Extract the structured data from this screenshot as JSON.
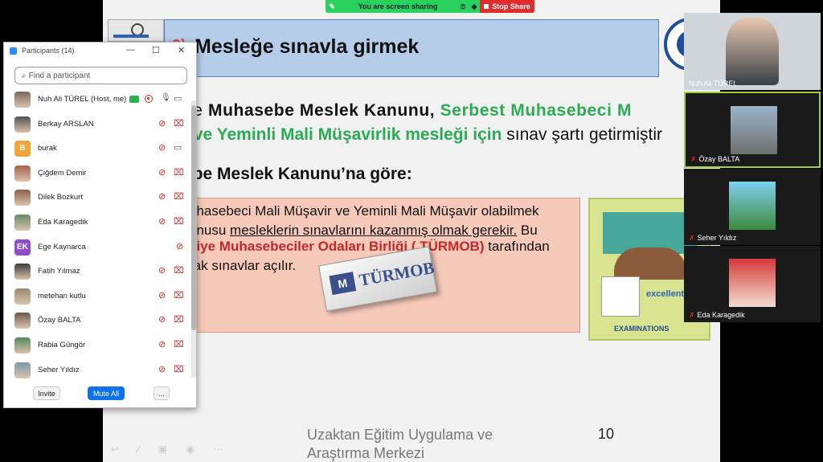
{
  "share_bar": {
    "status_label": "You are screen sharing",
    "stop_label": "Stop Share"
  },
  "slide": {
    "title_number": "2)",
    "title": "Mesleğe sınavla girmek",
    "line1_prefix": "de ",
    "line1_bold": "Muhasebe Meslek Kanunu,",
    "line1_green": " Serbest Muhasebeci M",
    "line2_green": "t ve Yeminli Mali Müşavirlik mesleği için",
    "line2_rest": " sınav şartı getirmiştir",
    "line3": "ebe Meslek Kanunu’na göre:",
    "box_line1": "uhasebeci Mali Müşavir ve Yeminli Mali Müşavir olabilmek",
    "box_line2_a": "onusu ",
    "box_line2_u": "mesleklerin sınavlarını kazanmış olmak gerekir.",
    "box_line2_b": " Bu",
    "box_line3_red": "kiye Muhasebeciler Odaları Birliği ( TÜRMOB)",
    "box_line3_rest": " tarafından",
    "box_line4": "rak sınavlar açılır.",
    "turmob_logo_text": "TÜRMOB",
    "exam_image_words": [
      "excellent",
      "EXAMINATIONS"
    ],
    "footer_line1": "Uzaktan Eğitim Uygulama ve",
    "footer_line2": "Araştırma Merkezi",
    "page_number": "10"
  },
  "participants_panel": {
    "title": "Participants (14)",
    "search_placeholder": "Find a participant",
    "participants": [
      {
        "name": "Nuh Ali TÜREL (Host, me)",
        "avatar": "photo",
        "mic": "on",
        "cam": "on"
      },
      {
        "name": "Berkay ARSLAN",
        "avatar": "photo",
        "mic": "muted",
        "cam": "off"
      },
      {
        "name": "burak",
        "avatar": "B",
        "avatar_color": "#f2a33a",
        "mic": "muted",
        "cam": "on"
      },
      {
        "name": "Çiğdem Demir",
        "avatar": "photo",
        "mic": "muted",
        "cam": "off"
      },
      {
        "name": "Dilek Bozkurt",
        "avatar": "photo",
        "mic": "muted",
        "cam": "off"
      },
      {
        "name": "Eda Karagedik",
        "avatar": "photo",
        "mic": "muted",
        "cam": "off"
      },
      {
        "name": "Ege Kaynarca",
        "avatar": "EK",
        "avatar_color": "#8d4fc5",
        "mic": "muted",
        "cam": "none"
      },
      {
        "name": "Fatih Yılmaz",
        "avatar": "photo",
        "mic": "muted",
        "cam": "off"
      },
      {
        "name": "metehan kutlu",
        "avatar": "photo",
        "mic": "muted",
        "cam": "off"
      },
      {
        "name": "Özay BALTA",
        "avatar": "photo",
        "mic": "muted",
        "cam": "off"
      },
      {
        "name": "Rabia Güngör",
        "avatar": "photo",
        "mic": "muted",
        "cam": "off"
      },
      {
        "name": "Seher Yıldız",
        "avatar": "photo",
        "mic": "muted",
        "cam": "off"
      }
    ],
    "invite_label": "Invite",
    "mute_all_label": "Mute All",
    "more_label": "..."
  },
  "video_tiles": [
    {
      "name": "Nuh Ali TÜREL",
      "muted": false
    },
    {
      "name": "Özay BALTA",
      "muted": true
    },
    {
      "name": "Seher Yıldız",
      "muted": true
    },
    {
      "name": "Eda Karagedik",
      "muted": true
    }
  ],
  "colors": {
    "share_green": "#2ad15c",
    "stop_red": "#e02c2c",
    "zoom_blue": "#0e72ed",
    "muted_red": "#d42c2c",
    "slide_green_text": "#2aab54",
    "slide_red_text": "#c4282a",
    "active_speaker_border": "#9fd23a"
  }
}
